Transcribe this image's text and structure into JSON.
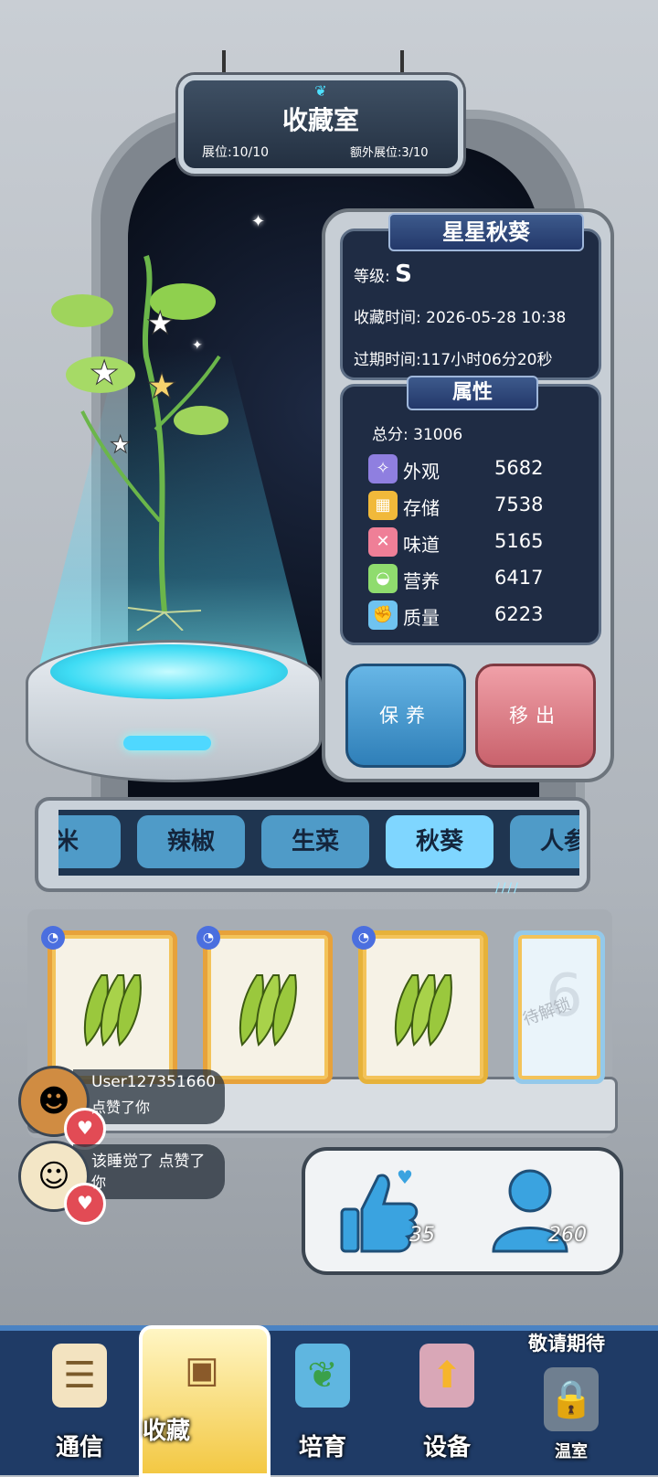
{
  "header": {
    "title": "收藏室",
    "slots_label": "展位:10/10",
    "extra_slots_label": "额外展位:3/10"
  },
  "plant": {
    "name": "星星秋葵",
    "grade_label": "等级:",
    "grade_value": "S",
    "collect_time_label": "收藏时间:",
    "collect_time_value": "2026-05-28 10:38",
    "expire_time_label": "过期时间:",
    "expire_time_value": "117小时06分20秒"
  },
  "attributes": {
    "title": "属性",
    "total_label": "总分:",
    "total_value": "31006",
    "items": [
      {
        "label": "外观",
        "value": "5682",
        "icon": "sparkle-icon",
        "color": "#8f7fe0"
      },
      {
        "label": "存储",
        "value": "7538",
        "icon": "crate-icon",
        "color": "#f1b93a"
      },
      {
        "label": "味道",
        "value": "5165",
        "icon": "utensils-icon",
        "color": "#ef7f97"
      },
      {
        "label": "营养",
        "value": "6417",
        "icon": "fruit-bowl-icon",
        "color": "#8fdc6e"
      },
      {
        "label": "质量",
        "value": "6223",
        "icon": "muscle-icon",
        "color": "#6fc3f0"
      }
    ]
  },
  "actions": {
    "care_label": "保养",
    "remove_label": "移出"
  },
  "categories": {
    "items": [
      "米",
      "辣椒",
      "生菜",
      "秋葵",
      "人参"
    ],
    "selected": "秋葵"
  },
  "shelf": {
    "locked_label": "待解锁",
    "locked_number": "6"
  },
  "notifications": [
    {
      "name": "User127351660",
      "message": "点赞了你"
    },
    {
      "name": "该睡觉了 点赞了",
      "message": "你"
    }
  ],
  "social": {
    "likes": "35",
    "followers": "260"
  },
  "nav": {
    "items": [
      "通信",
      "收藏",
      "培育",
      "设备",
      "温室"
    ],
    "coming_soon": "敬请期待"
  },
  "colors": {
    "accent": "#7fd6ff",
    "care": "#2f7fb8",
    "remove": "#c9626c"
  }
}
